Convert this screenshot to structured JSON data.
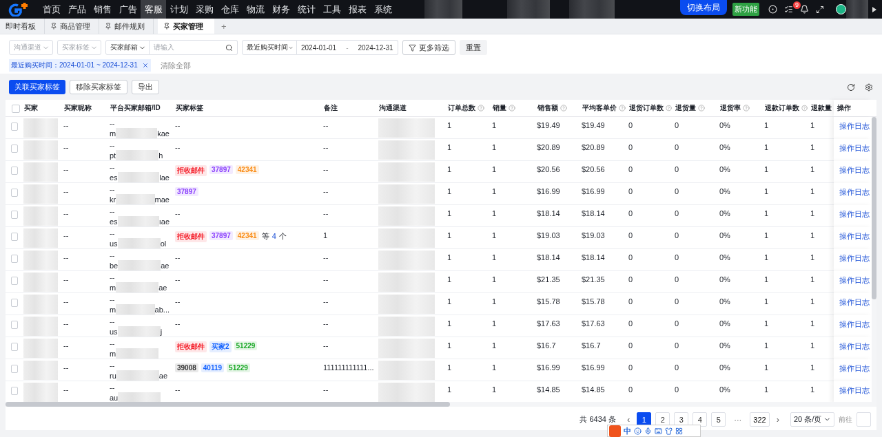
{
  "nav": {
    "items": [
      {
        "label": "首页",
        "selected": false
      },
      {
        "label": "产品",
        "selected": false
      },
      {
        "label": "销售",
        "selected": false
      },
      {
        "label": "广告",
        "selected": false
      },
      {
        "label": "客服",
        "selected": true
      },
      {
        "label": "计划",
        "selected": false
      },
      {
        "label": "采购",
        "selected": false
      },
      {
        "label": "仓库",
        "selected": false
      },
      {
        "label": "物流",
        "selected": false
      },
      {
        "label": "财务",
        "selected": false
      },
      {
        "label": "统计",
        "selected": false
      },
      {
        "label": "工具",
        "selected": false
      },
      {
        "label": "报表",
        "selected": false
      },
      {
        "label": "系统",
        "selected": false
      }
    ],
    "layout_button": "切换布局",
    "new_badge": "新功能",
    "task_count": "9"
  },
  "tabs": [
    {
      "label": "即时看板",
      "pinned": false,
      "selected": false
    },
    {
      "label": "商品管理",
      "pinned": true,
      "selected": false
    },
    {
      "label": "邮件规则",
      "pinned": true,
      "selected": false
    },
    {
      "label": "买家管理",
      "pinned": true,
      "selected": true
    },
    {
      "label": "+",
      "kind": "add",
      "selected": false
    }
  ],
  "filters": {
    "channel": {
      "placeholder": "沟通渠道"
    },
    "tag": {
      "placeholder": "买家标签"
    },
    "email_type": "买家邮箱",
    "email_input": {
      "placeholder": "请输入"
    },
    "date_type": "最近购买时间",
    "date_from": "2024-01-01",
    "date_sep": "-",
    "date_to": "2024-12-31",
    "more": "更多筛选",
    "reset": "重置",
    "chips": [
      {
        "label": "最近购买时间：2024-01-01 ~ 2024-12-31"
      }
    ],
    "clear_all": "清除全部"
  },
  "actions": [
    "关联买家标签",
    "移除买家标签",
    "导出"
  ],
  "table": {
    "header_checked": false,
    "columns": [
      {
        "label": "买家",
        "help": false
      },
      {
        "label": "买家昵称",
        "help": false
      },
      {
        "label": "平台买家邮箱/ID",
        "help": false
      },
      {
        "label": "买家标签",
        "help": false
      },
      {
        "label": "备注",
        "help": false
      },
      {
        "label": "沟通渠道",
        "help": false
      },
      {
        "label": "订单总数",
        "help": true
      },
      {
        "label": "销量",
        "help": true
      },
      {
        "label": "销售额",
        "help": true
      },
      {
        "label": "平均客单价",
        "help": true
      },
      {
        "label": "退货订单数",
        "help": true
      },
      {
        "label": "退货量",
        "help": true
      },
      {
        "label": "退货率",
        "help": true
      },
      {
        "label": "退款订单数",
        "help": true
      },
      {
        "label": "退款量"
      },
      {
        "label": "操作",
        "help": false
      }
    ],
    "rows": [
      {
        "checked": false,
        "nickname": "--",
        "email_id": "--",
        "email_head": "m",
        "email_tail": "kae",
        "tags": [],
        "no_tags": "--",
        "remark": "--",
        "values": [
          "1",
          "1",
          "$19.49",
          "$19.49",
          "0",
          "0",
          "0%",
          "1",
          "1"
        ],
        "action": "操作日志"
      },
      {
        "checked": false,
        "nickname": "--",
        "email_id": "--",
        "email_head": "pt",
        "email_tail": "h",
        "tags": [],
        "no_tags": "--",
        "remark": "--",
        "values": [
          "1",
          "1",
          "$20.89",
          "$20.89",
          "0",
          "0",
          "0%",
          "1",
          "1"
        ],
        "action": "操作日志"
      },
      {
        "checked": false,
        "nickname": "--",
        "email_id": "--",
        "email_head": "es",
        "email_tail": "lae",
        "tags": [
          {
            "text": "拒收邮件",
            "color": "#f5222d"
          },
          {
            "text": "37897",
            "color": "#8a3ffc"
          },
          {
            "text": "42341",
            "color": "#fa8c16"
          }
        ],
        "remark": "--",
        "values": [
          "1",
          "1",
          "$20.56",
          "$20.56",
          "0",
          "0",
          "0%",
          "1",
          "1"
        ],
        "action": "操作日志"
      },
      {
        "checked": false,
        "nickname": "--",
        "email_id": "--",
        "email_head": "kr",
        "email_tail": "mae",
        "tags": [
          {
            "text": "37897",
            "color": "#8a3ffc"
          }
        ],
        "remark": "--",
        "values": [
          "1",
          "1",
          "$16.99",
          "$16.99",
          "0",
          "0",
          "0%",
          "1",
          "1"
        ],
        "action": "操作日志"
      },
      {
        "checked": false,
        "nickname": "--",
        "email_id": "--",
        "email_head": "es",
        "email_tail": "ıae",
        "tags": [],
        "no_tags": "--",
        "remark": "--",
        "values": [
          "1",
          "1",
          "$18.14",
          "$18.14",
          "0",
          "0",
          "0%",
          "1",
          "1"
        ],
        "action": "操作日志"
      },
      {
        "checked": false,
        "nickname": "--",
        "email_id": "--",
        "email_head": "us",
        "email_tail": "ol",
        "tags": [
          {
            "text": "拒收邮件",
            "color": "#f5222d"
          },
          {
            "text": "37897",
            "color": "#8a3ffc"
          },
          {
            "text": "42341",
            "color": "#fa8c16"
          }
        ],
        "more": {
          "prefix": "等",
          "count": "4",
          "suffix": "个"
        },
        "remark": "1",
        "values": [
          "1",
          "1",
          "$19.03",
          "$19.03",
          "0",
          "0",
          "0%",
          "1",
          "1"
        ],
        "action": "操作日志"
      },
      {
        "checked": false,
        "nickname": "--",
        "email_id": "--",
        "email_head": "be",
        "email_tail": "ae",
        "tags": [],
        "no_tags": "--",
        "remark": "--",
        "values": [
          "1",
          "1",
          "$18.14",
          "$18.14",
          "0",
          "0",
          "0%",
          "1",
          "1"
        ],
        "action": "操作日志"
      },
      {
        "checked": false,
        "nickname": "--",
        "email_id": "--",
        "email_head": "m",
        "email_tail": "ae",
        "tags": [],
        "no_tags": "--",
        "remark": "--",
        "values": [
          "1",
          "1",
          "$21.35",
          "$21.35",
          "0",
          "0",
          "0%",
          "1",
          "1"
        ],
        "action": "操作日志"
      },
      {
        "checked": false,
        "nickname": "--",
        "email_id": "--",
        "email_head": "m",
        "email_tail": "ab...",
        "tags": [],
        "no_tags": "--",
        "remark": "--",
        "values": [
          "1",
          "1",
          "$15.78",
          "$15.78",
          "0",
          "0",
          "0%",
          "1",
          "1"
        ],
        "action": "操作日志"
      },
      {
        "checked": false,
        "nickname": "--",
        "email_id": "--",
        "email_head": "us",
        "email_tail": "j",
        "tags": [],
        "no_tags": "--",
        "remark": "--",
        "values": [
          "1",
          "1",
          "$17.63",
          "$17.63",
          "0",
          "0",
          "0%",
          "1",
          "1"
        ],
        "action": "操作日志"
      },
      {
        "checked": false,
        "nickname": "--",
        "email_id": "--",
        "email_head": "m",
        "tags": [
          {
            "text": "拒收邮件",
            "color": "#f5222d"
          },
          {
            "text": "买家2",
            "color": "#1664ff"
          },
          {
            "text": "51229",
            "color": "#18a825"
          }
        ],
        "remark": "--",
        "values": [
          "1",
          "1",
          "$16.7",
          "$16.7",
          "0",
          "0",
          "0%",
          "1",
          "1"
        ],
        "action": "操作日志"
      },
      {
        "checked": false,
        "nickname": "--",
        "email_id": "--",
        "email_head": "ru",
        "email_tail": "ae",
        "tags": [
          {
            "text": "39008",
            "color": "#333333"
          },
          {
            "text": "40119",
            "color": "#1664ff"
          },
          {
            "text": "51229",
            "color": "#18a825"
          }
        ],
        "remark": "111111111111...",
        "values": [
          "1",
          "1",
          "$16.99",
          "$16.99",
          "0",
          "0",
          "0%",
          "1",
          "1"
        ],
        "action": "操作日志"
      },
      {
        "checked": false,
        "nickname": "--",
        "email_id": "--",
        "email_head": "au",
        "tags": [],
        "no_tags": "--",
        "remark": "--",
        "values": [
          "1",
          "1",
          "$14.85",
          "$14.85",
          "0",
          "0",
          "0%",
          "1",
          "1"
        ],
        "action": "操作日志"
      }
    ]
  },
  "pagination": {
    "total": "共 6434 条",
    "prev": "‹",
    "pages": [
      {
        "label": "1",
        "selected": true
      },
      {
        "label": "2",
        "selected": false
      },
      {
        "label": "3",
        "selected": false
      },
      {
        "label": "4",
        "selected": false
      },
      {
        "label": "5",
        "selected": false
      }
    ],
    "ellipsis": "···",
    "last": "322",
    "next": "›",
    "page_size": "20 条/页",
    "goto": "前往"
  },
  "ime": {
    "mode": "中"
  }
}
